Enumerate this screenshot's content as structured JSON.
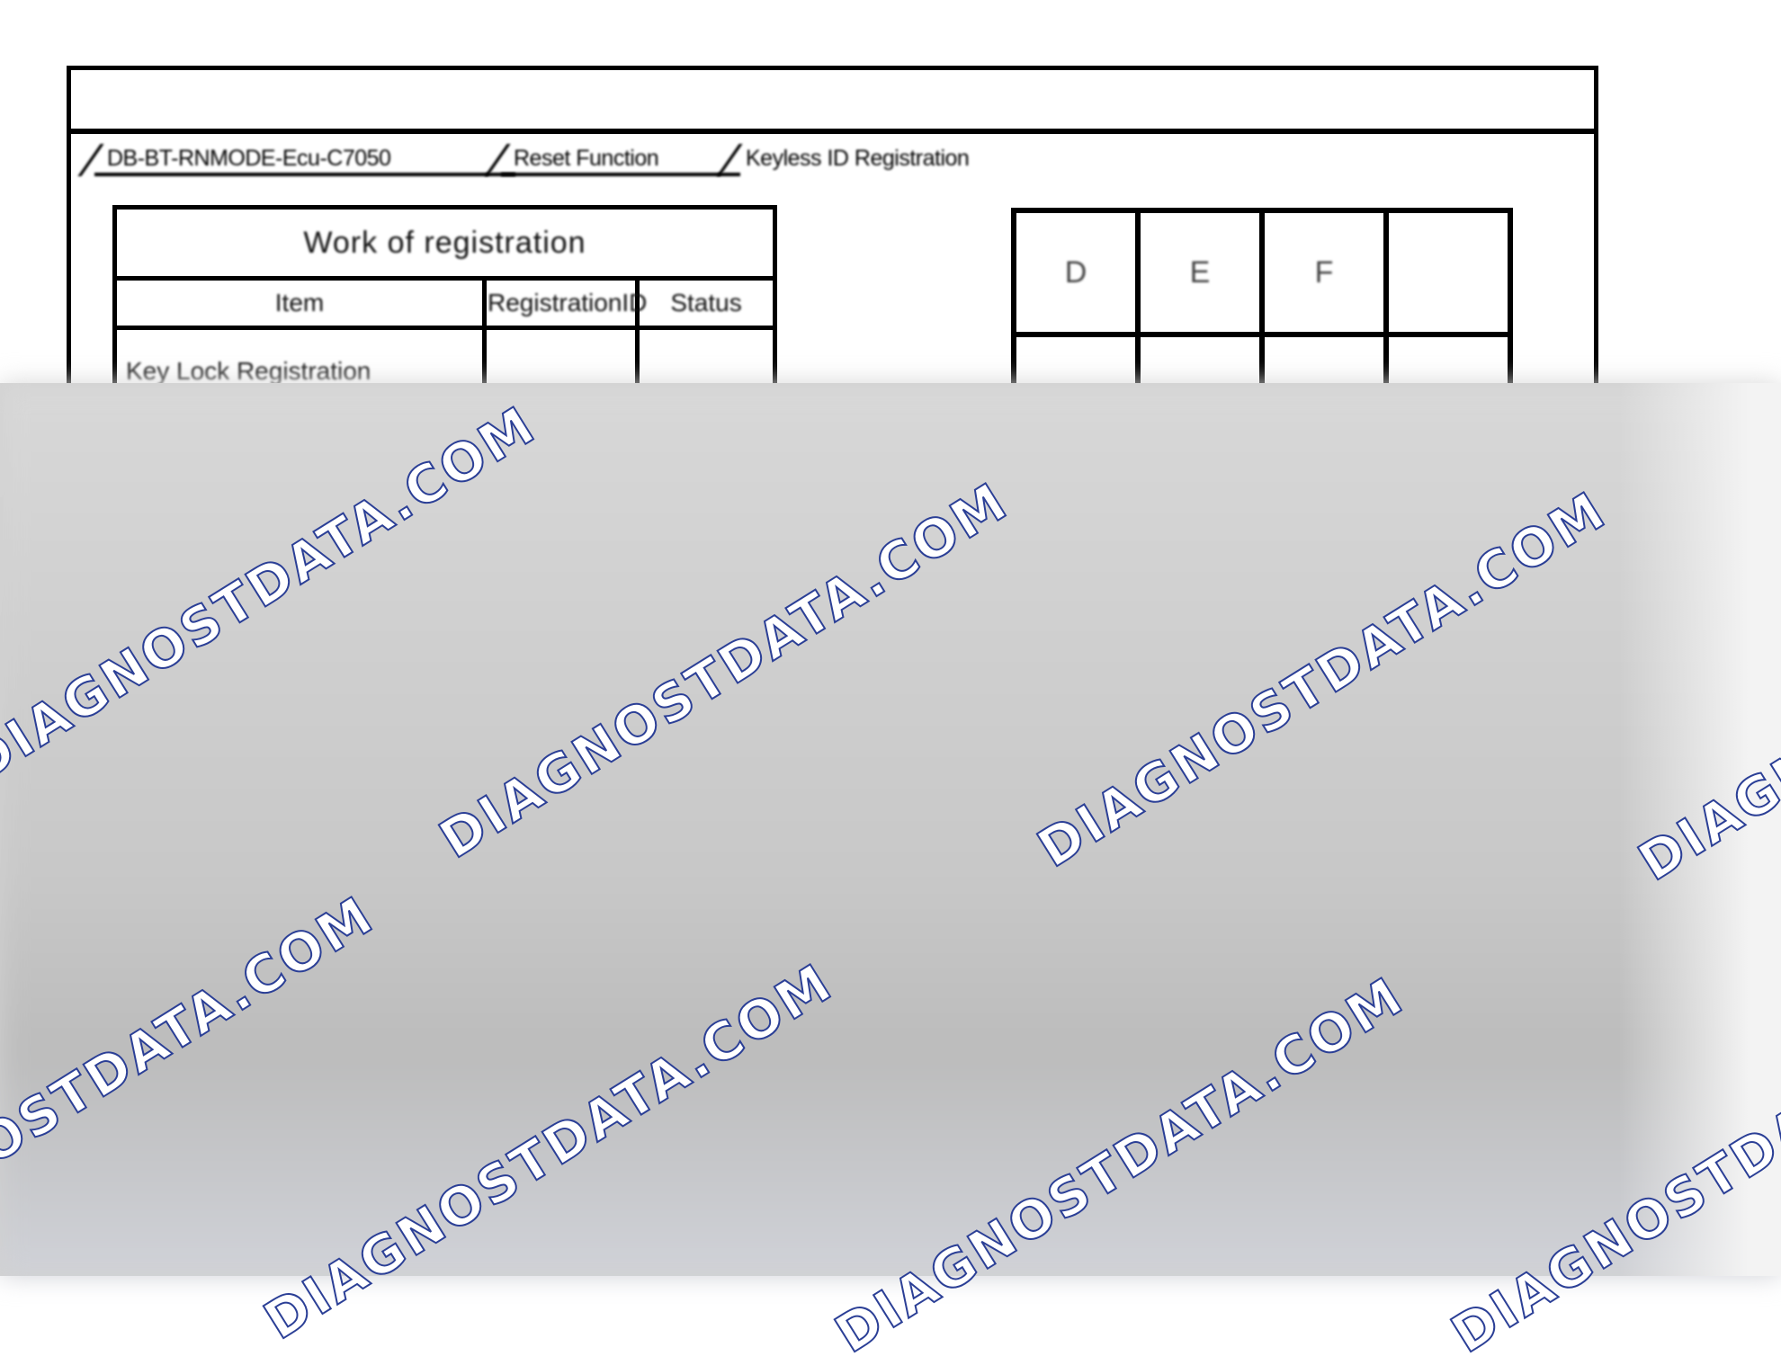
{
  "window": {
    "title": ""
  },
  "tabs": [
    {
      "label": "DB-BT-RNMODE-Ecu-C7050",
      "active": false
    },
    {
      "label": "Reset Function",
      "active": false
    },
    {
      "label": "Keyless ID Registration",
      "active": true
    }
  ],
  "registration_table": {
    "caption": "Work of registration",
    "headers": [
      "Item",
      "RegistrationID",
      "Status"
    ],
    "rows": [
      {
        "item": "Key Lock Registration",
        "registration_id": "",
        "status": ""
      }
    ]
  },
  "grid": {
    "header": [
      "D",
      "E",
      "F",
      ""
    ],
    "row2": [
      "",
      "",
      "",
      ""
    ]
  },
  "watermark": {
    "text": "DIAGNOSTDATA.COM",
    "color": "#2b3f96"
  }
}
